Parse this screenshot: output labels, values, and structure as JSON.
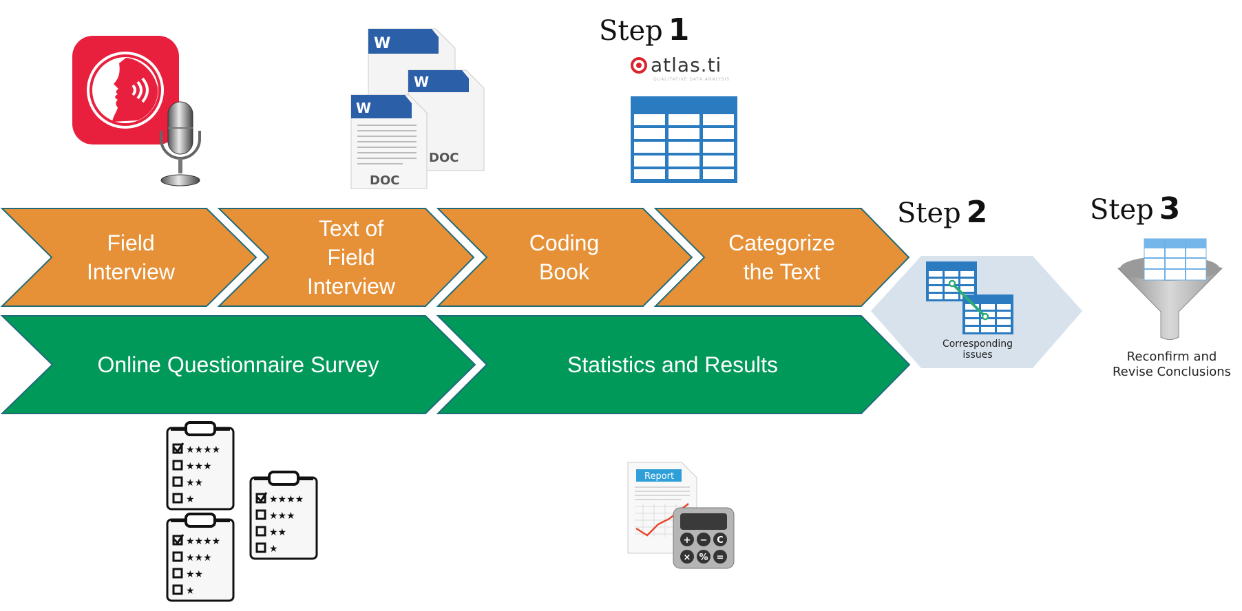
{
  "colors": {
    "orange": "#E69138",
    "green": "#00995A",
    "outline": "#1F6A7A",
    "hexagon": "#D7E2EC",
    "table_blue": "#2A7BC0",
    "app_red": "#E8203E"
  },
  "process_row": {
    "steps": [
      {
        "label": "Field\nInterview"
      },
      {
        "label": "Text of\nField\nInterview"
      },
      {
        "label": "Coding\nBook"
      },
      {
        "label": "Categorize\nthe Text"
      }
    ]
  },
  "survey_row": {
    "steps": [
      {
        "label": "Online Questionnaire Survey"
      },
      {
        "label": "Statistics and Results"
      }
    ]
  },
  "step_labels": [
    {
      "word": "Step",
      "number": "1"
    },
    {
      "word": "Step",
      "number": "2"
    },
    {
      "word": "Step",
      "number": "3"
    }
  ],
  "icons": {
    "speech_app": "speech-app-icon",
    "microphone": "microphone-icon",
    "word_docs": {
      "name": "word-documents-icon",
      "letter": "W",
      "ext": "DOC"
    },
    "atlas_logo": {
      "name": "atlas-ti-logo",
      "brand": "atlas.ti",
      "tagline": "QUALITATIVE DATA ANALYSIS"
    },
    "coding_table": "table-icon",
    "clipboards": "rating-clipboard-icon",
    "report": {
      "name": "report-calculator-icon",
      "title": "Report",
      "keys": [
        "+",
        "−",
        "C",
        "×",
        "%",
        "="
      ]
    },
    "funnel": "funnel-icon"
  },
  "step2_caption": "Corresponding\nissues",
  "step3_caption": "Reconfirm and\nRevise Conclusions"
}
